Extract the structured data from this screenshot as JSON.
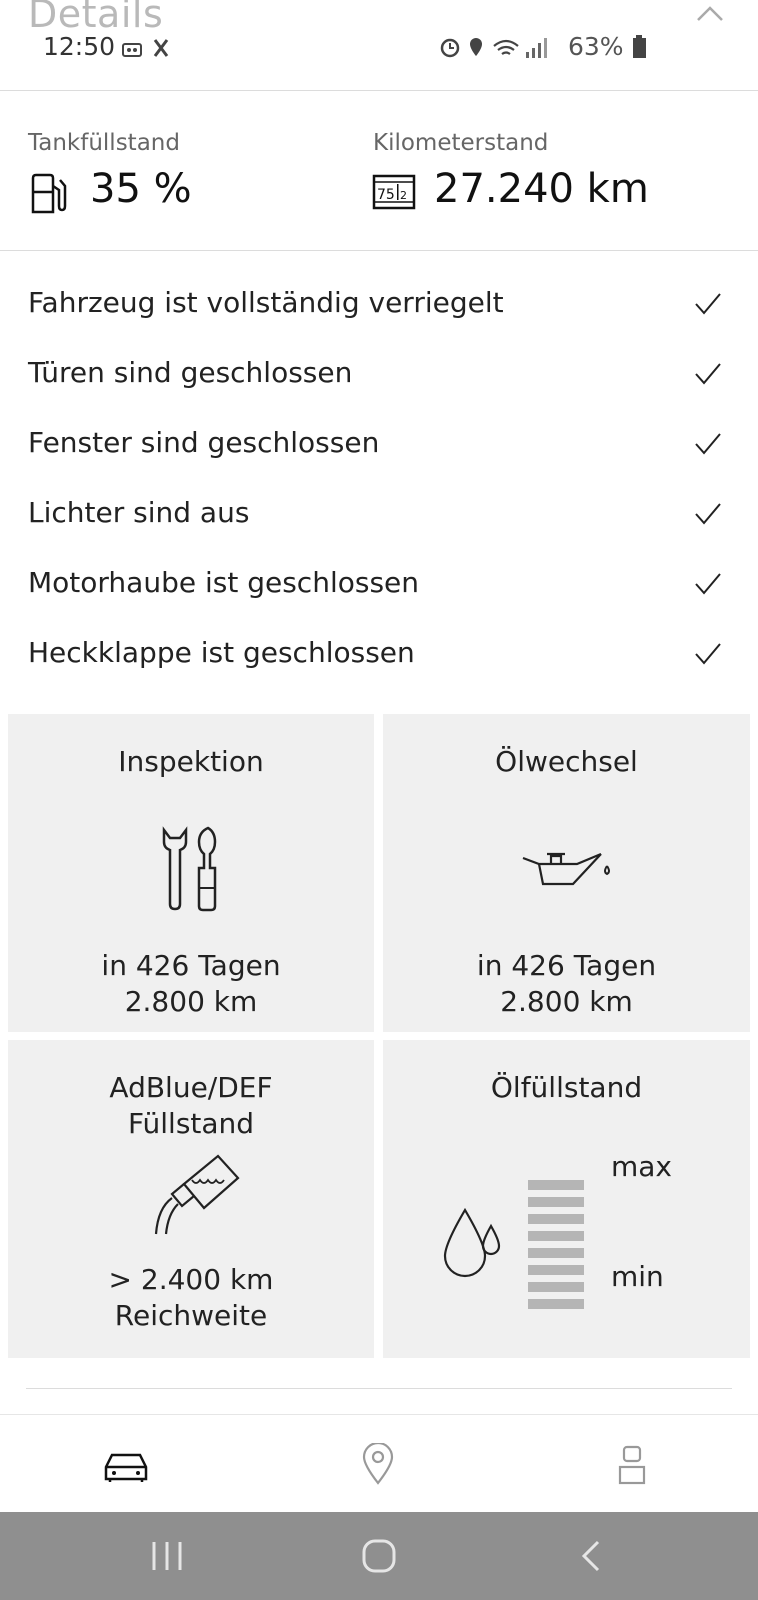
{
  "header": {
    "title": "Details"
  },
  "status_bar": {
    "time": "12:50",
    "battery": "63%"
  },
  "stats": {
    "fuel": {
      "label": "Tankfüllstand",
      "value": "35 %"
    },
    "mileage": {
      "label": "Kilometerstand",
      "value": "27.240 km"
    }
  },
  "status_list": [
    {
      "text": "Fahrzeug ist vollständig verriegelt"
    },
    {
      "text": "Türen sind geschlossen"
    },
    {
      "text": "Fenster sind geschlossen"
    },
    {
      "text": "Lichter sind aus"
    },
    {
      "text": "Motorhaube ist geschlossen"
    },
    {
      "text": "Heckklappe ist geschlossen"
    }
  ],
  "tiles": {
    "inspection": {
      "title": "Inspektion",
      "line1": "in 426 Tagen",
      "line2": "2.800 km"
    },
    "oil_change": {
      "title": "Ölwechsel",
      "line1": "in 426 Tagen",
      "line2": "2.800 km"
    },
    "adblue": {
      "title1": "AdBlue/DEF",
      "title2": "Füllstand",
      "line1": "> 2.400 km",
      "line2": "Reichweite"
    },
    "oil_level": {
      "title": "Ölfüllstand",
      "max_label": "max",
      "min_label": "min"
    }
  },
  "icons": {
    "fuel": "fuel-pump-icon",
    "odometer": "odometer-icon",
    "check": "check-icon",
    "tools": "wrench-screwdriver-icon",
    "oilcan": "oil-can-icon",
    "adblue": "adblue-bottle-icon",
    "drops": "oil-drops-icon",
    "nav_car": "car-icon",
    "nav_map": "location-pin-icon",
    "nav_profile": "profile-icon"
  }
}
